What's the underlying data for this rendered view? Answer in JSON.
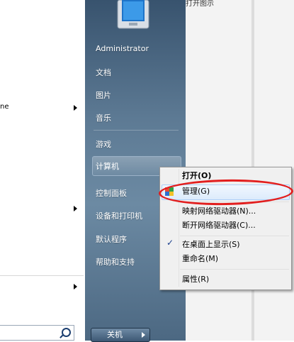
{
  "left_pane": {
    "fragment_text": "ne"
  },
  "start_menu": {
    "items": [
      {
        "label": "Administrator"
      },
      {
        "label": "文档"
      },
      {
        "label": "图片"
      },
      {
        "label": "音乐"
      },
      {
        "label": "游戏"
      },
      {
        "label": "计算机"
      },
      {
        "label": "控制面板"
      },
      {
        "label": "设备和打印机"
      },
      {
        "label": "默认程序"
      },
      {
        "label": "帮助和支持"
      }
    ],
    "shutdown_label": "关机"
  },
  "desktop": {
    "top_text": "打开图示"
  },
  "context_menu": {
    "items": [
      {
        "label": "打开(O)"
      },
      {
        "label": "管理(G)"
      },
      {
        "label": "映射网络驱动器(N)..."
      },
      {
        "label": "断开网络驱动器(C)..."
      },
      {
        "label": "在桌面上显示(S)"
      },
      {
        "label": "重命名(M)"
      },
      {
        "label": "属性(R)"
      }
    ],
    "check_glyph": "✓"
  },
  "colors": {
    "annotation_red": "#e21e1e",
    "menu_blue": "#5d7a94"
  }
}
